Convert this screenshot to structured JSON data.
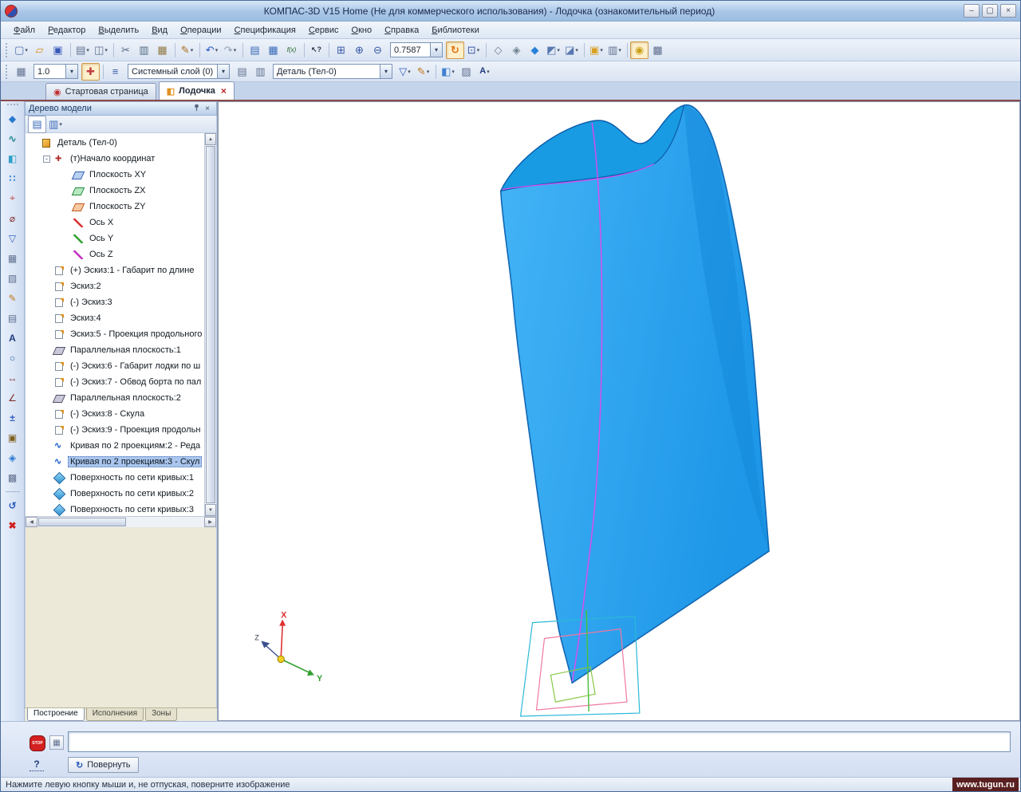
{
  "window": {
    "title": "КОМПАС-3D V15 Home (Не для коммерческого использования) - Лодочка (ознакомительный период)",
    "controls": {
      "minimize": "‒",
      "restore": "▢",
      "close": "×"
    }
  },
  "icons": {
    "chevron_down": "▾",
    "close": "×",
    "pin": "✚",
    "up": "▲",
    "down": "▼",
    "left": "◀",
    "right": "▶",
    "stop_label": "STOP",
    "question": "?",
    "rotate": "↻"
  },
  "menu": {
    "items": [
      {
        "name": "menu-file",
        "label": "Файл"
      },
      {
        "name": "menu-editor",
        "label": "Редактор"
      },
      {
        "name": "menu-select",
        "label": "Выделить"
      },
      {
        "name": "menu-view",
        "label": "Вид"
      },
      {
        "name": "menu-operations",
        "label": "Операции"
      },
      {
        "name": "menu-specification",
        "label": "Спецификация"
      },
      {
        "name": "menu-service",
        "label": "Сервис"
      },
      {
        "name": "menu-window",
        "label": "Окно"
      },
      {
        "name": "menu-help",
        "label": "Справка"
      },
      {
        "name": "menu-libraries",
        "label": "Библиотеки"
      }
    ]
  },
  "toolbar1": {
    "zoom_value": "0.7587",
    "group_a": [
      {
        "name": "new-document-button",
        "glyph": "▢",
        "style": "color:#4a70b0",
        "arrow": "▾"
      },
      {
        "name": "open-button",
        "glyph": "▱",
        "style": "color:#d89020"
      },
      {
        "name": "save-button",
        "glyph": "▣",
        "style": "color:#3858b8"
      },
      {
        "name": "separator",
        "kind": "sep",
        "inter": "false"
      },
      {
        "name": "print-button",
        "glyph": "▤",
        "style": "color:#607090",
        "arrow": "▾"
      },
      {
        "name": "print-preview-button",
        "glyph": "◫",
        "style": "color:#607090",
        "arrow": "▾"
      },
      {
        "name": "separator",
        "kind": "sep",
        "inter": "false"
      },
      {
        "name": "cut-button",
        "glyph": "✂",
        "style": "color:#506880"
      },
      {
        "name": "copy-button",
        "glyph": "▥",
        "style": "color:#506880"
      },
      {
        "name": "paste-button",
        "glyph": "▦",
        "style": "color:#907840"
      },
      {
        "name": "separator",
        "kind": "sep",
        "inter": "false"
      },
      {
        "name": "copy-properties-button",
        "glyph": "✎",
        "style": "color:#b07020",
        "arrow": "▾"
      },
      {
        "name": "separator",
        "kind": "sep",
        "inter": "false"
      },
      {
        "name": "undo-button",
        "glyph": "↶",
        "style": "color:#2858c8",
        "arrow": "▾"
      },
      {
        "name": "redo-button",
        "glyph": "↷",
        "style": "color:#90a0b8",
        "arrow": "▾"
      },
      {
        "name": "separator",
        "kind": "sep",
        "inter": "false"
      },
      {
        "name": "specification-button",
        "glyph": "▤",
        "style": "color:#3868b8"
      },
      {
        "name": "spec-objects-button",
        "glyph": "▦",
        "style": "color:#3868b8"
      },
      {
        "name": "variables-button",
        "glyph": "f(x)",
        "style": "color:#206020;font-size:8px;font-style:italic"
      },
      {
        "name": "separator",
        "kind": "sep",
        "inter": "false"
      },
      {
        "name": "context-help-button",
        "glyph": "↖?",
        "style": "color:#303848;font-size:9px;font-weight:bold"
      },
      {
        "name": "separator",
        "kind": "sep",
        "inter": "false"
      },
      {
        "name": "zoom-rect-button",
        "glyph": "⊞",
        "style": "color:#3858a8"
      },
      {
        "name": "zoom-in-button",
        "glyph": "⊕",
        "style": "color:#3858a8"
      },
      {
        "name": "zoom-out-button",
        "glyph": "⊖",
        "style": "color:#3858a8"
      }
    ],
    "group_b": [
      {
        "name": "refresh-view-button",
        "glyph": "↻",
        "style": "color:#e07818;font-weight:bold",
        "pressed": "true"
      },
      {
        "name": "show-all-button",
        "glyph": "⊡",
        "style": "color:#3858a8",
        "arrow": "▾"
      },
      {
        "name": "separator",
        "kind": "sep",
        "inter": "false"
      },
      {
        "name": "wireframe-display-button",
        "glyph": "◇",
        "style": "color:#708090"
      },
      {
        "name": "hidden-lines-display-button",
        "glyph": "◈",
        "style": "color:#708090"
      },
      {
        "name": "shaded-display-button",
        "glyph": "◆",
        "style": "color:#2880d8"
      },
      {
        "name": "orientation-button",
        "glyph": "◩",
        "style": "color:#5878b0",
        "arrow": "▾"
      },
      {
        "name": "projection-button",
        "glyph": "◪",
        "style": "color:#5878b0",
        "arrow": "▾"
      },
      {
        "name": "separator",
        "kind": "sep",
        "inter": "false"
      },
      {
        "name": "model-modes-button",
        "glyph": "▣",
        "style": "color:#d8a020",
        "arrow": "▾"
      },
      {
        "name": "clipboard-3d-button",
        "glyph": "▥",
        "style": "color:#607090",
        "arrow": "▾"
      },
      {
        "name": "separator",
        "kind": "sep",
        "inter": "false"
      },
      {
        "name": "quick-display-button",
        "glyph": "◉",
        "style": "color:#c8a018",
        "pressed": "true"
      },
      {
        "name": "display-settings-button",
        "glyph": "▩",
        "style": "color:#607090"
      }
    ]
  },
  "toolbar2": {
    "step_value": "1.0",
    "layer_value": "Системный слой (0)",
    "part_value": "Деталь (Тел-0)",
    "group_a": [
      {
        "name": "document-grid-button",
        "glyph": "▦",
        "style": "color:#607090"
      }
    ],
    "group_b": [
      {
        "name": "snap-toggle-button",
        "glyph": "✚",
        "style": "color:#c04040",
        "pressed": "true"
      },
      {
        "name": "separator",
        "kind": "sep",
        "inter": "false"
      },
      {
        "name": "layers-button",
        "glyph": "≡",
        "style": "color:#3858a8"
      }
    ],
    "group_c": [
      {
        "name": "layer-settings-button",
        "glyph": "▤",
        "style": "color:#607090"
      },
      {
        "name": "new-layer-button",
        "glyph": "▥",
        "style": "color:#607090"
      }
    ],
    "group_d": [
      {
        "name": "filter-button",
        "glyph": "▽",
        "style": "color:#3060c0",
        "arrow": "▾"
      },
      {
        "name": "style-pen-button",
        "glyph": "✎",
        "style": "color:#c07820",
        "arrow": "▾"
      },
      {
        "name": "separator",
        "kind": "sep",
        "inter": "false"
      },
      {
        "name": "fill-button",
        "glyph": "◧",
        "style": "color:#4080d0",
        "arrow": "▾"
      },
      {
        "name": "hatch-button",
        "glyph": "▨",
        "style": "color:#607090"
      },
      {
        "name": "text-style-button",
        "glyph": "A",
        "style": "color:#203a80;font-size:11px;font-weight:bold",
        "arrow": "▾"
      }
    ]
  },
  "doc_tabs": [
    {
      "name": "tab-start-page",
      "label": "Стартовая страница",
      "glyph": "◉",
      "icon_style": "color:#c03030"
    },
    {
      "name": "tab-lodochka",
      "label": "Лодочка",
      "glyph": "◧",
      "icon_style": "color:#e09020",
      "active": "true",
      "close": "×"
    }
  ],
  "left_toolbar": {
    "items": [
      {
        "name": "edit-part-tool",
        "glyph": "◆",
        "style": "color:#2878d0"
      },
      {
        "name": "spatial-curves-tool",
        "glyph": "∿",
        "style": "color:#208890;font-weight:bold"
      },
      {
        "name": "surfaces-tool",
        "glyph": "◧",
        "style": "color:#30a0c8"
      },
      {
        "name": "arrays-tool",
        "glyph": "∷",
        "style": "color:#2878d0;font-weight:bold"
      },
      {
        "name": "auxiliary-geometry-tool",
        "glyph": "⌖",
        "style": "color:#c05050"
      },
      {
        "name": "measurements-tool",
        "glyph": "⌀",
        "style": "color:#803030"
      },
      {
        "name": "filters-tool",
        "glyph": "▽",
        "style": "color:#3060c0"
      },
      {
        "name": "specification-tool",
        "glyph": "▦",
        "style": "color:#607090"
      },
      {
        "name": "reports-tool",
        "glyph": "▧",
        "style": "color:#607090"
      },
      {
        "name": "design-elements-tool",
        "glyph": "✎",
        "style": "color:#c07820"
      },
      {
        "name": "sheet-metal-tool",
        "glyph": "▤",
        "style": "color:#607090"
      },
      {
        "name": "text-tool",
        "glyph": "A",
        "style": "color:#203a80;font-weight:bold"
      },
      {
        "name": "geometry-tool",
        "glyph": "○",
        "style": "color:#2060a0;font-weight:bold"
      },
      {
        "name": "dimensions-tool",
        "glyph": "↔",
        "style": "color:#803030"
      },
      {
        "name": "designations-tool",
        "glyph": "∠",
        "style": "color:#803030"
      },
      {
        "name": "parameterization-tool",
        "glyph": "±",
        "style": "color:#3060c0;font-weight:bold"
      },
      {
        "name": "libraries-tool",
        "glyph": "▣",
        "style": "color:#806020"
      },
      {
        "name": "applications-tool",
        "glyph": "◈",
        "style": "color:#2878d0"
      },
      {
        "name": "macro-tool",
        "glyph": "▩",
        "style": "color:#607090"
      },
      {
        "name": "separator",
        "kind": "sep",
        "inter": "false"
      },
      {
        "name": "rebuild-tool",
        "glyph": "↺",
        "style": "color:#3060c0;font-weight:bold"
      },
      {
        "name": "interrupt-command-button",
        "glyph": "✖",
        "style": "color:#d02020;font-weight:bold"
      }
    ]
  },
  "tree": {
    "title": "Дерево модели",
    "toolbar": [
      {
        "name": "tree-structure-button",
        "glyph": "▤",
        "style": "color:#3868b8",
        "pressed": "true"
      },
      {
        "name": "tree-composition-button",
        "glyph": "▥",
        "style": "color:#3868b8",
        "arrow": "▾"
      }
    ],
    "items": [
      {
        "name": "tree-item-detail",
        "label": "Деталь (Тел-0)",
        "icon": "part",
        "level": "0"
      },
      {
        "name": "tree-item-origin",
        "label": "(т)Начало координат",
        "icon": "origin",
        "level": "1",
        "exp": "-"
      },
      {
        "name": "tree-item-plane-xy",
        "label": "Плоскость XY",
        "icon": "plane-xy",
        "level": "2"
      },
      {
        "name": "tree-item-plane-zx",
        "label": "Плоскость ZX",
        "icon": "plane-zx",
        "level": "2"
      },
      {
        "name": "tree-item-plane-zy",
        "label": "Плоскость ZY",
        "icon": "plane-zy",
        "level": "2"
      },
      {
        "name": "tree-item-axis-x",
        "label": "Ось X",
        "icon": "axis-x",
        "level": "2"
      },
      {
        "name": "tree-item-axis-y",
        "label": "Ось Y",
        "icon": "axis-y",
        "level": "2"
      },
      {
        "name": "tree-item-axis-z",
        "label": "Ось Z",
        "icon": "axis-z",
        "level": "2"
      },
      {
        "name": "tree-item-sketch-1",
        "label": "(+) Эскиз:1 - Габарит по длине",
        "icon": "sketch",
        "level": "1"
      },
      {
        "name": "tree-item-sketch-2",
        "label": "Эскиз:2",
        "icon": "sketch",
        "level": "1"
      },
      {
        "name": "tree-item-sketch-3",
        "label": "(-) Эскиз:3",
        "icon": "sketch",
        "level": "1"
      },
      {
        "name": "tree-item-sketch-4",
        "label": "Эскиз:4",
        "icon": "sketch",
        "level": "1"
      },
      {
        "name": "tree-item-sketch-5",
        "label": "Эскиз:5 - Проекция продольного",
        "icon": "sketch",
        "level": "1"
      },
      {
        "name": "tree-item-parallel-plane-1",
        "label": "Параллельная плоскость:1",
        "icon": "pplane",
        "level": "1"
      },
      {
        "name": "tree-item-sketch-6",
        "label": "(-) Эскиз:6 - Габарит лодки по ш",
        "icon": "sketch",
        "level": "1"
      },
      {
        "name": "tree-item-sketch-7",
        "label": "(-) Эскиз:7 - Обвод борта по пал",
        "icon": "sketch",
        "level": "1"
      },
      {
        "name": "tree-item-parallel-plane-2",
        "label": "Параллельная плоскость:2",
        "icon": "pplane",
        "level": "1"
      },
      {
        "name": "tree-item-sketch-8",
        "label": "(-) Эскиз:8 - Скула",
        "icon": "sketch",
        "level": "1"
      },
      {
        "name": "tree-item-sketch-9",
        "label": "(-) Эскиз:9 - Проекция продольн",
        "icon": "sketch",
        "level": "1"
      },
      {
        "name": "tree-item-curve-2",
        "label": "Кривая по 2 проекциям:2 - Реда",
        "icon": "curve",
        "level": "1"
      },
      {
        "name": "tree-item-curve-3",
        "label": "Кривая по 2 проекциям:3 - Скул",
        "icon": "curve",
        "level": "1",
        "sel": "true"
      },
      {
        "name": "tree-item-surface-1",
        "label": "Поверхность по сети кривых:1",
        "icon": "surface",
        "level": "1"
      },
      {
        "name": "tree-item-surface-2",
        "label": "Поверхность по сети кривых:2",
        "icon": "surface",
        "level": "1"
      },
      {
        "name": "tree-item-surface-3",
        "label": "Поверхность по сети кривых:3",
        "icon": "surface",
        "level": "1"
      }
    ],
    "tabs": [
      {
        "name": "tree-tab-postroenie",
        "label": "Построение",
        "active": "true"
      },
      {
        "name": "tree-tab-ispolneniya",
        "label": "Исполнения"
      },
      {
        "name": "tree-tab-zony",
        "label": "Зоны"
      }
    ]
  },
  "viewport": {
    "axes": {
      "x": "X",
      "y": "Y",
      "z": "Z"
    }
  },
  "bottom_bar": {
    "input_value": "",
    "rotate_label": "Повернуть"
  },
  "status": {
    "message": "Нажмите левую кнопку мыши и, не отпуская, поверните изображение",
    "watermark": "www.tugun.ru"
  }
}
